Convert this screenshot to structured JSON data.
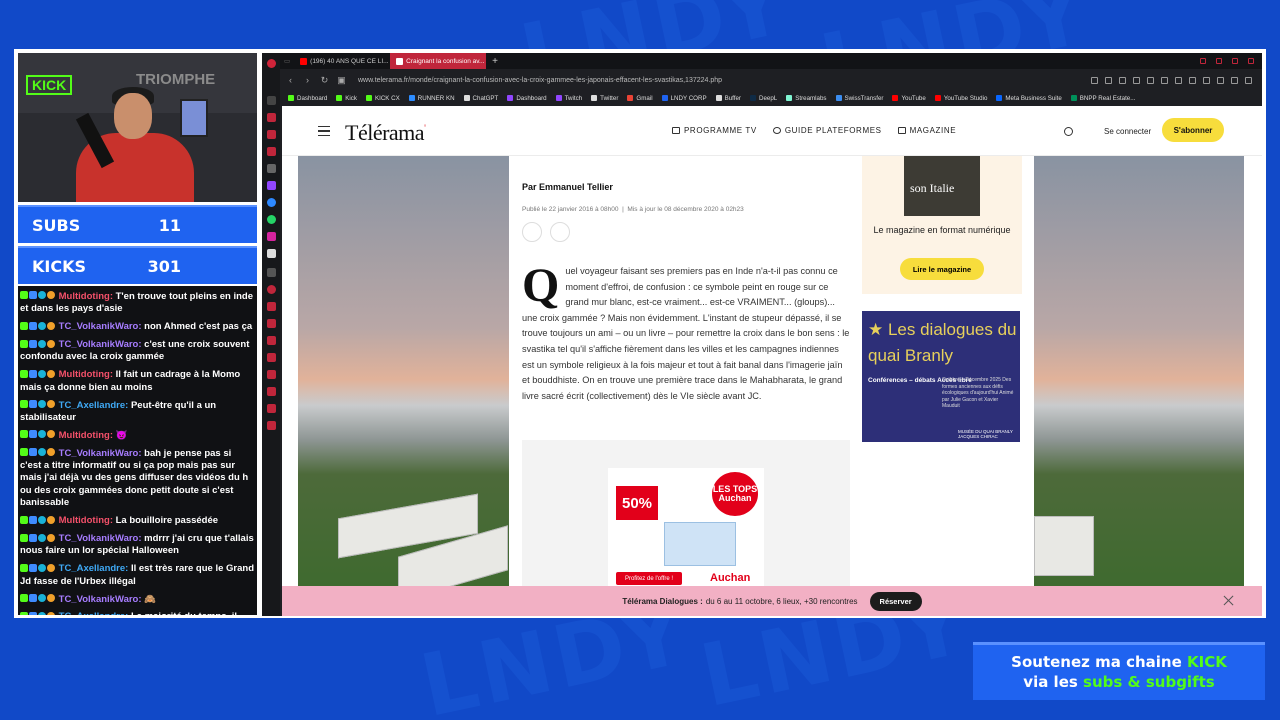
{
  "background": {
    "watermark": "LNDY"
  },
  "overlay": {
    "cam_sign": "KICK",
    "cam_poster": "TRIOMPHE",
    "subs_label": "SUBS",
    "subs_value": "11",
    "kicks_label": "KICKS",
    "kicks_value": "301"
  },
  "chat": [
    {
      "user": "Multidoting:",
      "color": "#f4516a",
      "text": "T'en trouve tout pleins en inde et dans les pays d'asie"
    },
    {
      "user": "TC_VolkanikWaro:",
      "color": "#a77dff",
      "text": "non Ahmed c'est pas ça"
    },
    {
      "user": "TC_VolkanikWaro:",
      "color": "#a77dff",
      "text": "c'est une croix souvent confondu avec la croix gammée"
    },
    {
      "user": "Multidoting:",
      "color": "#f4516a",
      "text": "Il fait un cadrage à la Momo mais ça donne bien au moins"
    },
    {
      "user": "TC_Axellandre:",
      "color": "#3fa9f5",
      "text": "Peut-être qu'il a un stabilisateur"
    },
    {
      "user": "Multidoting:",
      "color": "#f4516a",
      "text": "😈"
    },
    {
      "user": "TC_VolkanikWaro:",
      "color": "#a77dff",
      "text": "bah je pense pas si c'est a titre informatif ou si ça pop mais pas sur mais j'ai déjà vu des gens diffuser des vidéos du h ou des croix gammées donc petit doute si c'est banissable"
    },
    {
      "user": "Multidoting:",
      "color": "#f4516a",
      "text": "La bouilloire passédée"
    },
    {
      "user": "TC_VolkanikWaro:",
      "color": "#a77dff",
      "text": "mdrrr j'ai cru que t'allais nous faire un lor spécial Halloween"
    },
    {
      "user": "TC_Axellandre:",
      "color": "#3fa9f5",
      "text": "Il est très rare que le Grand Jd fasse de l'Urbex illégal"
    },
    {
      "user": "TC_VolkanikWaro:",
      "color": "#a77dff",
      "text": "🙈"
    },
    {
      "user": "TC_Axellandre:",
      "color": "#3fa9f5",
      "text": "La majorité du temps, il demande des autoriwaitons"
    }
  ],
  "browser": {
    "tabs": [
      {
        "label": "(196) 40 ANS QUE CE LI...",
        "active": false
      },
      {
        "label": "Craignant la confusion av...",
        "active": true
      }
    ],
    "url": "www.telerama.fr/monde/craignant-la-confusion-avec-la-croix-gammee-les-japonais-effacent-les-svastikas,137224.php",
    "bookmarks": [
      "Dashboard",
      "Kick",
      "KICK CX",
      "RUNNER KN",
      "ChatGPT",
      "Dashboard",
      "Twitch",
      "Twitter",
      "Gmail",
      "LNDY CORP",
      "Buffer",
      "DeepL",
      "Streamlabs",
      "SwissTransfer",
      "YouTube",
      "YouTube Studio",
      "Meta Business Suite",
      "BNPP Real Estate..."
    ]
  },
  "site": {
    "logo": "Télérama",
    "logo_mark": "'",
    "nav": [
      "PROGRAMME TV",
      "GUIDE PLATEFORMES",
      "MAGAZINE"
    ],
    "login": "Se connecter",
    "subscribe": "S'abonner"
  },
  "article": {
    "author": "Par Emmanuel Tellier",
    "published": "Publié le 22 janvier 2016 à 08h00",
    "updated": "Mis à jour le 08 décembre 2020 à 02h23",
    "dropcap": "Q",
    "body": "uel voyageur faisant ses premiers pas en Inde n'a-t-il pas connu ce moment d'effroi, de confusion : ce symbole peint en rouge sur ce grand mur blanc, est-ce vraiment... est-ce VRAIMENT... (gloups)... une croix gammée ? Mais non évidemment. L'instant de stupeur dépassé, il se trouve toujours un ami – ou un livre – pour remettre la croix dans le bon sens : le svastika tel qu'il s'affiche fièrement dans les villes et les campagnes indiennes est un symbole religieux à la fois majeur et tout à fait banal dans l'imagerie jaïn et bouddhiste. On en trouve une première trace dans le Mahabharata, le grand livre sacré écrit (collectivement) dès le VIe siècle avant JC."
  },
  "ad": {
    "percent": "50%",
    "tops": "LES TOPS Auchan",
    "cta": "Profitez de l'offre !",
    "brand": "Auchan"
  },
  "magazine": {
    "cover_text": "son Italie",
    "title": "Le magazine en format numérique",
    "button": "Lire le magazine"
  },
  "promo": {
    "title": "★ Les dialogues du quai Branly",
    "sub": "Conférences – débats Accès libre",
    "dates": "Octobre – Décembre 2025 Des formes anciennes aux défis écologiques d'aujourd'hui Animé par Julie Gacon et Xavier Mauduit",
    "footer": "MUSÉE DU QUAI BRANLY JACQUES CHIRAC"
  },
  "banner": {
    "bold": "Télérama Dialogues :",
    "text": "du 6 au 11 octobre, 6 lieux, +30 rencontres",
    "button": "Réserver"
  },
  "support": {
    "line1": "Soutenez ma chaine",
    "kick": "KICK",
    "line2a": "via les",
    "line2b": "subs & subgifts"
  }
}
